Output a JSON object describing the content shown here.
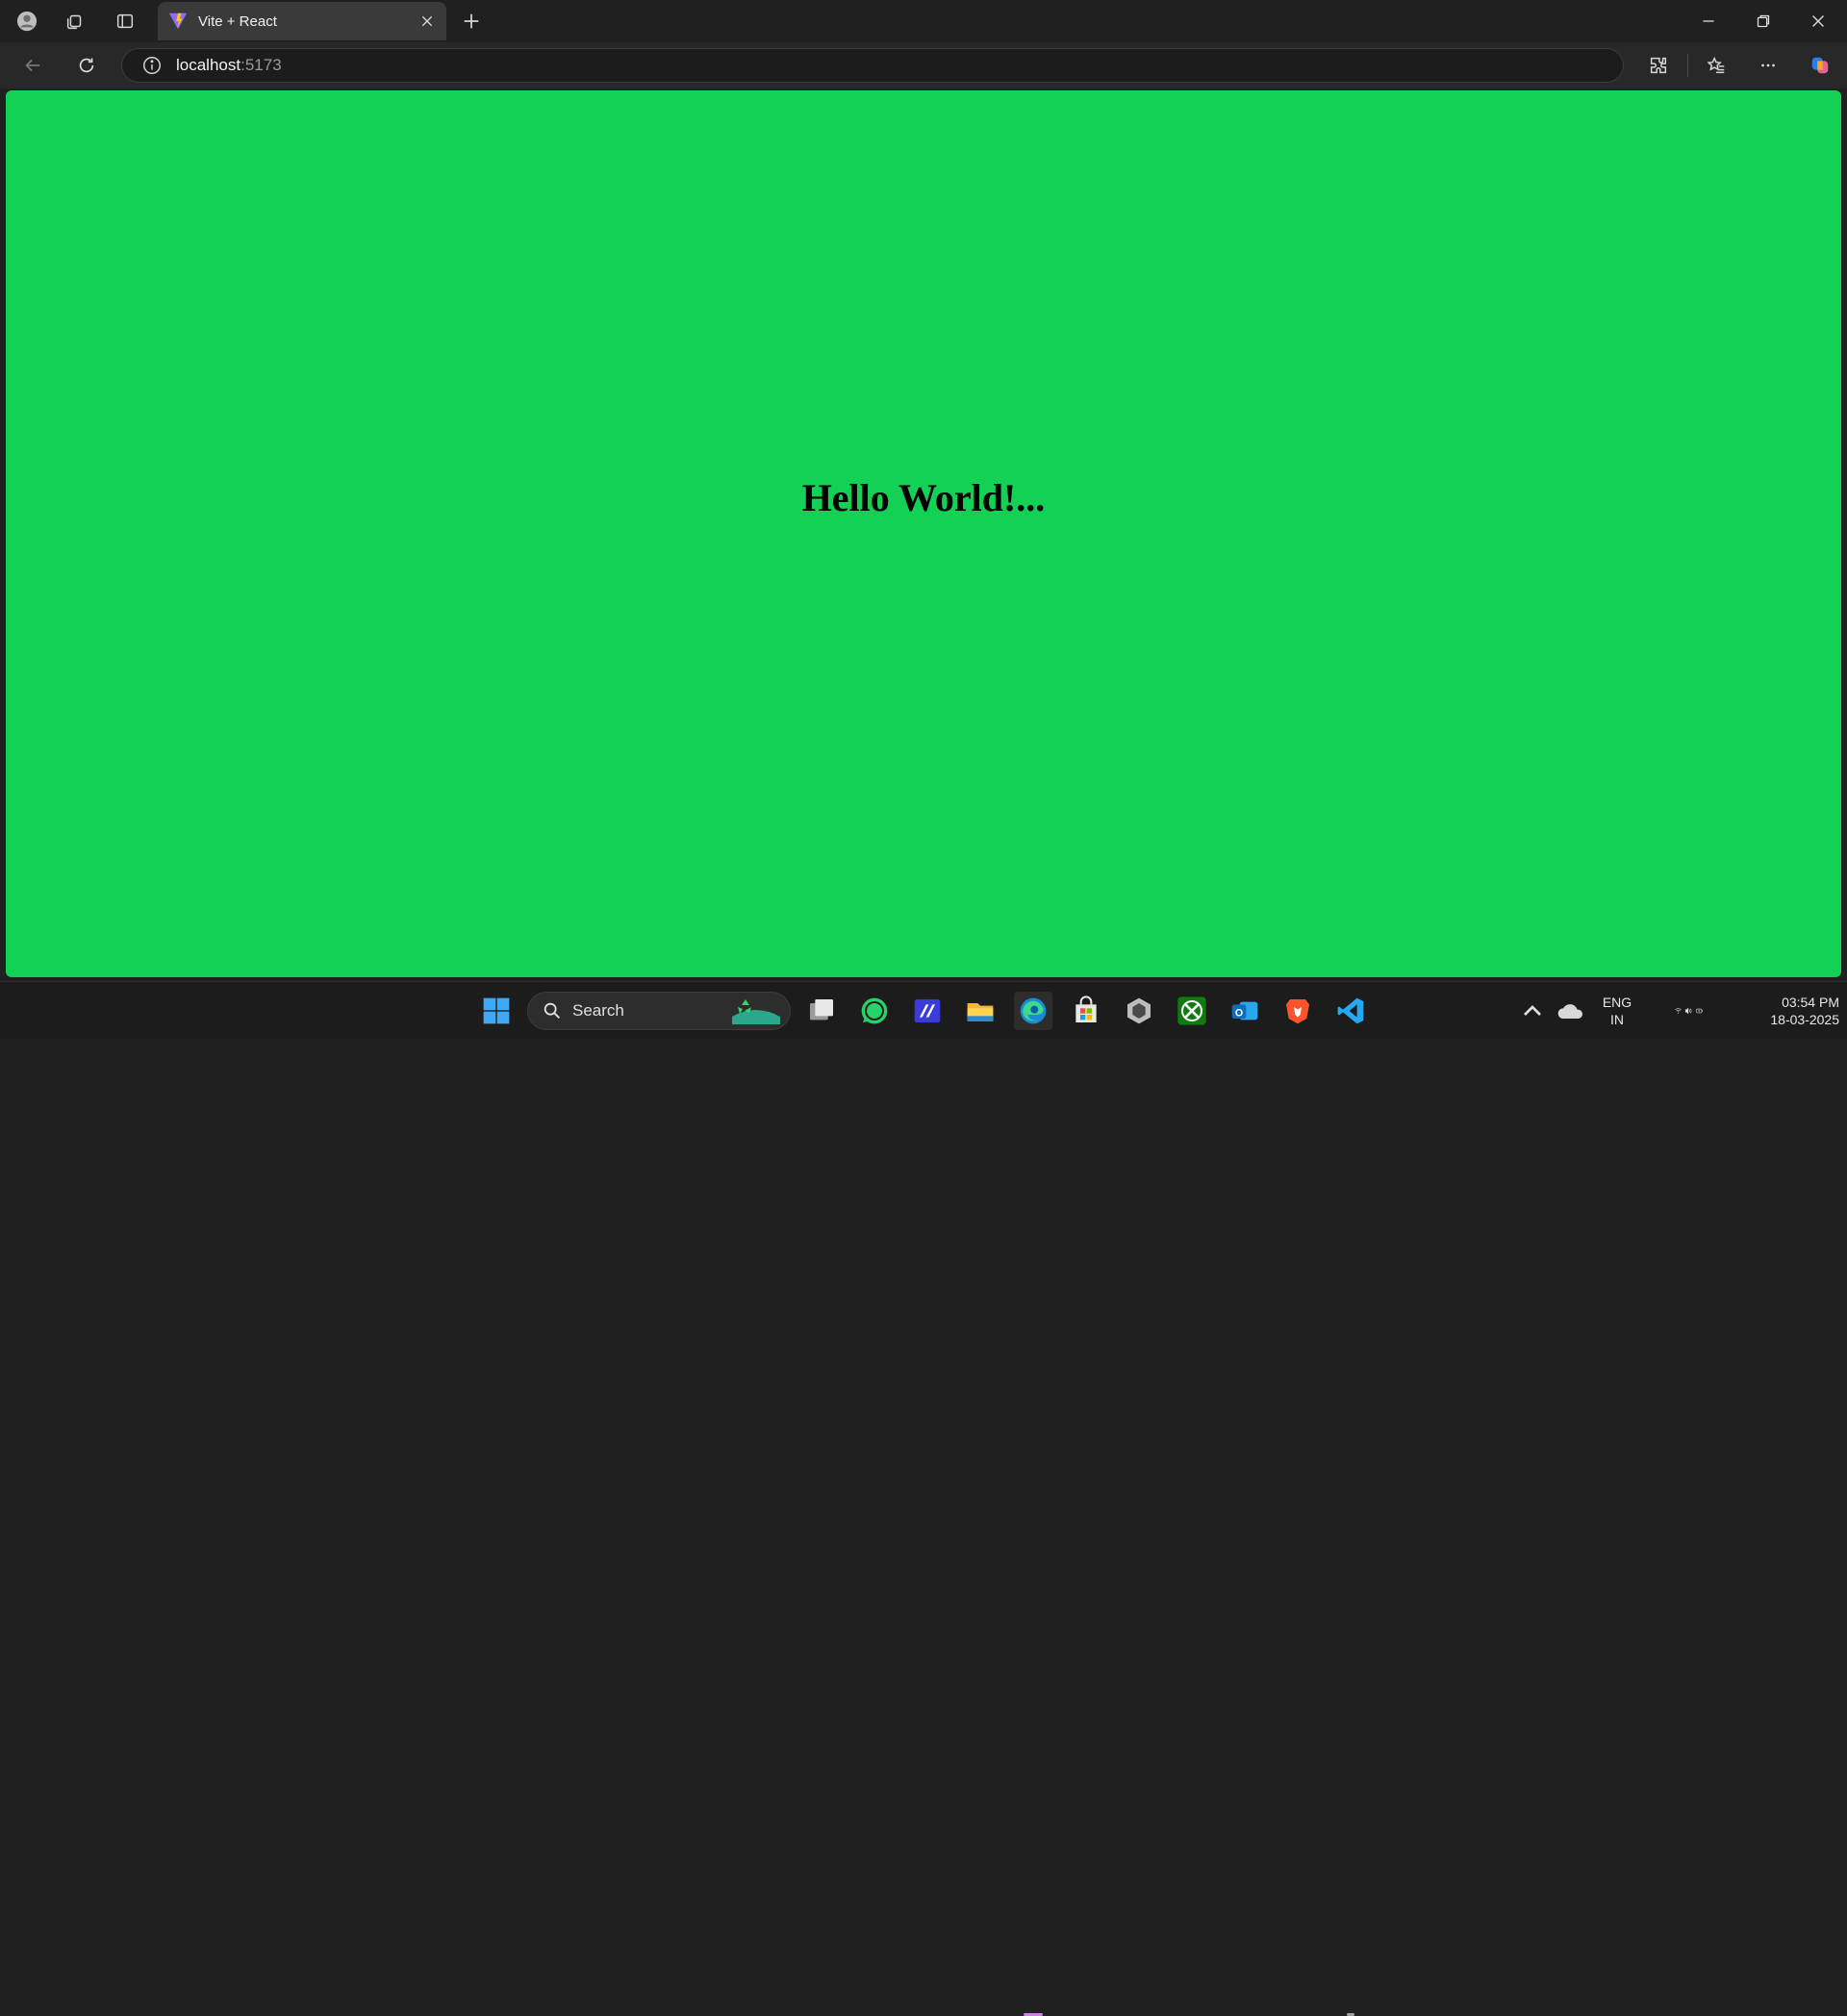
{
  "browser": {
    "tab_title": "Vite + React",
    "address_host": "localhost",
    "address_port": ":5173"
  },
  "page": {
    "heading": "Hello World!...",
    "background": "#12d155"
  },
  "taskbar": {
    "search_label": "Search",
    "lang_line1": "ENG",
    "lang_line2": "IN",
    "time": "03:54 PM",
    "date": "18-03-2025"
  }
}
